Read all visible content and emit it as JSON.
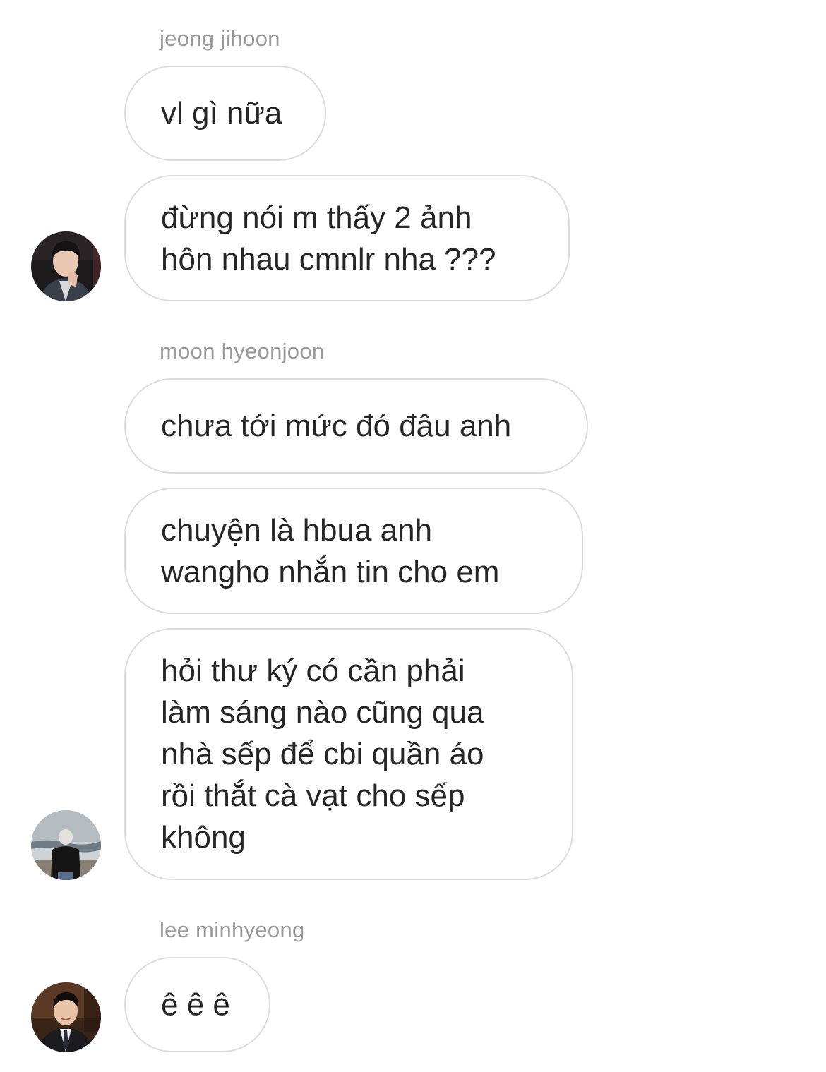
{
  "colors": {
    "bubble_border": "#dcdcdc",
    "sender_name": "#9a9a9a",
    "message_text": "#262626",
    "background": "#ffffff"
  },
  "groups": [
    {
      "sender": "jeong jihoon",
      "avatar": "profile-photo-man-in-suit-hand-on-chin",
      "messages": [
        {
          "text": "vl gì nữa"
        },
        {
          "text": "đừng nói m thấy 2 ảnh\nhôn nhau cmnlr nha ???"
        }
      ]
    },
    {
      "sender": "moon hyeonjoon",
      "avatar": "profile-photo-man-facing-sea",
      "messages": [
        {
          "text": "chưa tới mức đó đâu anh"
        },
        {
          "text": "chuyện là hbua anh\nwangho nhắn tin cho em"
        },
        {
          "text": "hỏi thư ký có cần phải\nlàm sáng nào cũng qua\nnhà sếp để cbi quần áo\nrồi thắt cà vạt cho sếp\nkhông"
        }
      ]
    },
    {
      "sender": "lee minhyeong",
      "avatar": "profile-photo-man-in-suit-smiling",
      "messages": [
        {
          "text": "ê ê ê"
        }
      ]
    }
  ]
}
